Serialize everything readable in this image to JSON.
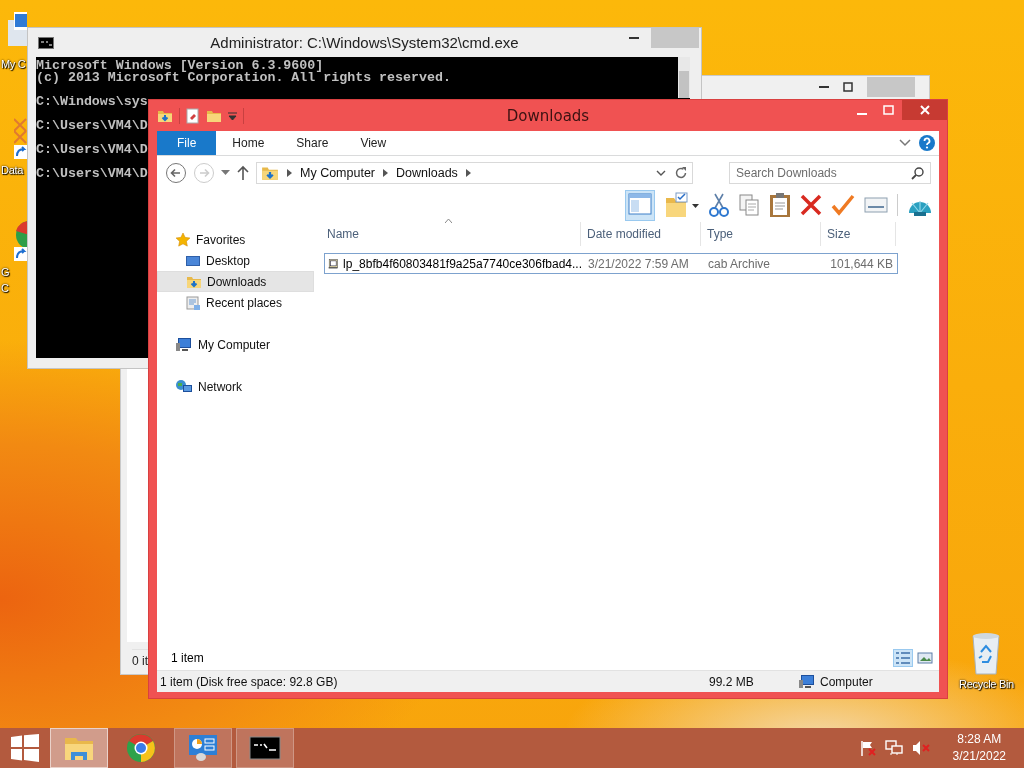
{
  "desktop_icons": [
    {
      "kind": "computer",
      "lines": [
        "My C"
      ]
    },
    {
      "kind": "shortcut",
      "lines": [
        "Data"
      ]
    },
    {
      "kind": "chrome",
      "lines": [
        "G",
        "C"
      ]
    }
  ],
  "recycle_bin": {
    "label": "Recycle Bin"
  },
  "back_window": {
    "status": "0 it"
  },
  "cmd": {
    "title": "Administrator: C:\\Windows\\System32\\cmd.exe",
    "lines": [
      "Microsoft Windows [Version 6.3.9600]",
      "(c) 2013 Microsoft Corporation. All rights reserved.",
      "C:\\Windows\\sys",
      "C:\\Users\\VM4\\D",
      "C:\\Users\\VM4\\D",
      "C:\\Users\\VM4\\D"
    ]
  },
  "explorer": {
    "title": "Downloads",
    "ribbon_tabs": [
      {
        "label": "File",
        "kind": "menu"
      },
      {
        "label": "Home",
        "kind": "tab"
      },
      {
        "label": "Share",
        "kind": "tab"
      },
      {
        "label": "View",
        "kind": "tab"
      }
    ],
    "address": [
      "My Computer",
      "Downloads"
    ],
    "search": {
      "placeholder": "Search Downloads"
    },
    "preview_pane": {
      "selected": true
    },
    "nav": [
      {
        "label": "Favorites",
        "kind": "favorites",
        "selected": false,
        "children": [
          {
            "label": "Desktop",
            "kind": "desktop",
            "selected": false
          },
          {
            "label": "Downloads",
            "kind": "downloads",
            "selected": true
          },
          {
            "label": "Recent places",
            "kind": "recent",
            "selected": false
          }
        ]
      },
      {
        "label": "My Computer",
        "kind": "computer",
        "selected": false
      },
      {
        "label": "Network",
        "kind": "network",
        "selected": false
      }
    ],
    "columns": [
      {
        "label": "Name",
        "sorted": true
      },
      {
        "label": "Date modified"
      },
      {
        "label": "Type"
      },
      {
        "label": "Size"
      }
    ],
    "rows": [
      {
        "name": "lp_8bfb4f60803481f9a25a7740ce306fbad4...",
        "date": "3/21/2022 7:59 AM",
        "type": "cab Archive",
        "size": "101,644 KB",
        "selected": true
      }
    ],
    "item_count": "1 item",
    "views": [
      {
        "kind": "details",
        "selected": true
      },
      {
        "kind": "large-icons",
        "selected": false
      }
    ],
    "status_bar": {
      "items": "1 item (Disk free space: 92.8 GB)",
      "size": "99.2 MB",
      "location": "Computer"
    }
  },
  "taskbar": {
    "apps": [
      {
        "kind": "explorer",
        "selected": true,
        "running": true
      },
      {
        "kind": "chrome",
        "selected": false,
        "running": false
      },
      {
        "kind": "control-panel",
        "selected": false,
        "running": true
      },
      {
        "kind": "cmd",
        "selected": false,
        "running": true
      }
    ],
    "time": "8:28 AM",
    "date": "3/21/2022"
  }
}
